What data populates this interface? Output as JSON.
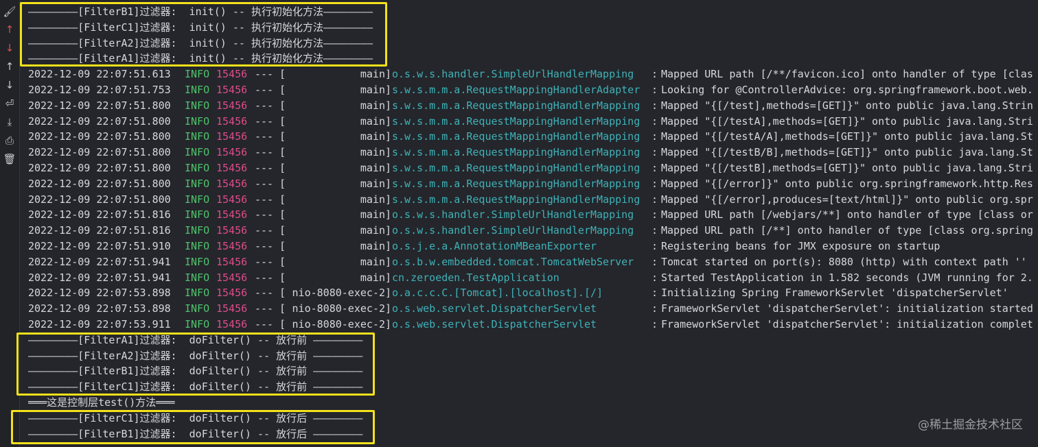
{
  "toolbar": [
    {
      "icon": "brush-icon",
      "glyph": "🖌"
    },
    {
      "icon": "arrow-up-red-icon",
      "glyph": "↑"
    },
    {
      "icon": "arrow-down-red-icon",
      "glyph": "↓"
    },
    {
      "icon": "arrow-up-icon",
      "glyph": "↑"
    },
    {
      "icon": "arrow-down-icon",
      "glyph": "↓"
    },
    {
      "icon": "wrap-lines-icon",
      "glyph": "⏎"
    },
    {
      "icon": "scroll-to-end-icon",
      "glyph": "⤓"
    },
    {
      "icon": "print-icon",
      "glyph": "⎙"
    },
    {
      "icon": "trash-icon",
      "glyph": "🗑"
    }
  ],
  "filter_init": [
    "————————[FilterB1]过滤器:  init() -- 执行初始化方法————————",
    "————————[FilterC1]过滤器:  init() -- 执行初始化方法————————",
    "————————[FilterA2]过滤器:  init() -- 执行初始化方法————————",
    "————————[FilterA1]过滤器:  init() -- 执行初始化方法————————"
  ],
  "log_lines": [
    {
      "ts": "2022-12-09 22:07:51.613",
      "level": "INFO",
      "pid": "15456",
      "sep": "---",
      "thread": "main",
      "logger": "o.s.w.s.handler.SimpleUrlHandlerMapping",
      "msg": "Mapped URL path [/**/favicon.ico] onto handler of type [clas"
    },
    {
      "ts": "2022-12-09 22:07:51.753",
      "level": "INFO",
      "pid": "15456",
      "sep": "---",
      "thread": "main",
      "logger": "s.w.s.m.m.a.RequestMappingHandlerAdapter",
      "msg": "Looking for @ControllerAdvice: org.springframework.boot.web."
    },
    {
      "ts": "2022-12-09 22:07:51.800",
      "level": "INFO",
      "pid": "15456",
      "sep": "---",
      "thread": "main",
      "logger": "s.w.s.m.m.a.RequestMappingHandlerMapping",
      "msg": "Mapped \"{[/test],methods=[GET]}\" onto public java.lang.Strin"
    },
    {
      "ts": "2022-12-09 22:07:51.800",
      "level": "INFO",
      "pid": "15456",
      "sep": "---",
      "thread": "main",
      "logger": "s.w.s.m.m.a.RequestMappingHandlerMapping",
      "msg": "Mapped \"{[/testA],methods=[GET]}\" onto public java.lang.Stri"
    },
    {
      "ts": "2022-12-09 22:07:51.800",
      "level": "INFO",
      "pid": "15456",
      "sep": "---",
      "thread": "main",
      "logger": "s.w.s.m.m.a.RequestMappingHandlerMapping",
      "msg": "Mapped \"{[/testA/A],methods=[GET]}\" onto public java.lang.St"
    },
    {
      "ts": "2022-12-09 22:07:51.800",
      "level": "INFO",
      "pid": "15456",
      "sep": "---",
      "thread": "main",
      "logger": "s.w.s.m.m.a.RequestMappingHandlerMapping",
      "msg": "Mapped \"{[/testB/B],methods=[GET]}\" onto public java.lang.St"
    },
    {
      "ts": "2022-12-09 22:07:51.800",
      "level": "INFO",
      "pid": "15456",
      "sep": "---",
      "thread": "main",
      "logger": "s.w.s.m.m.a.RequestMappingHandlerMapping",
      "msg": "Mapped \"{[/testB],methods=[GET]}\" onto public java.lang.Stri"
    },
    {
      "ts": "2022-12-09 22:07:51.800",
      "level": "INFO",
      "pid": "15456",
      "sep": "---",
      "thread": "main",
      "logger": "s.w.s.m.m.a.RequestMappingHandlerMapping",
      "msg": "Mapped \"{[/error]}\" onto public org.springframework.http.Res"
    },
    {
      "ts": "2022-12-09 22:07:51.800",
      "level": "INFO",
      "pid": "15456",
      "sep": "---",
      "thread": "main",
      "logger": "s.w.s.m.m.a.RequestMappingHandlerMapping",
      "msg": "Mapped \"{[/error],produces=[text/html]}\" onto public org.spr"
    },
    {
      "ts": "2022-12-09 22:07:51.816",
      "level": "INFO",
      "pid": "15456",
      "sep": "---",
      "thread": "main",
      "logger": "o.s.w.s.handler.SimpleUrlHandlerMapping",
      "msg": "Mapped URL path [/webjars/**] onto handler of type [class or"
    },
    {
      "ts": "2022-12-09 22:07:51.816",
      "level": "INFO",
      "pid": "15456",
      "sep": "---",
      "thread": "main",
      "logger": "o.s.w.s.handler.SimpleUrlHandlerMapping",
      "msg": "Mapped URL path [/**] onto handler of type [class org.spring"
    },
    {
      "ts": "2022-12-09 22:07:51.910",
      "level": "INFO",
      "pid": "15456",
      "sep": "---",
      "thread": "main",
      "logger": "o.s.j.e.a.AnnotationMBeanExporter",
      "msg": "Registering beans for JMX exposure on startup"
    },
    {
      "ts": "2022-12-09 22:07:51.941",
      "level": "INFO",
      "pid": "15456",
      "sep": "---",
      "thread": "main",
      "logger": "o.s.b.w.embedded.tomcat.TomcatWebServer",
      "msg": "Tomcat started on port(s): 8080 (http) with context path ''"
    },
    {
      "ts": "2022-12-09 22:07:51.941",
      "level": "INFO",
      "pid": "15456",
      "sep": "---",
      "thread": "main",
      "logger": "cn.zeroeden.TestApplication",
      "msg": "Started TestApplication in 1.582 seconds (JVM running for 2."
    },
    {
      "ts": "2022-12-09 22:07:53.898",
      "level": "INFO",
      "pid": "15456",
      "sep": "---",
      "thread": "nio-8080-exec-2",
      "logger": "o.a.c.c.C.[Tomcat].[localhost].[/]",
      "msg": "Initializing Spring FrameworkServlet 'dispatcherServlet'"
    },
    {
      "ts": "2022-12-09 22:07:53.898",
      "level": "INFO",
      "pid": "15456",
      "sep": "---",
      "thread": "nio-8080-exec-2",
      "logger": "o.s.web.servlet.DispatcherServlet",
      "msg": "FrameworkServlet 'dispatcherServlet': initialization started"
    },
    {
      "ts": "2022-12-09 22:07:53.911",
      "level": "INFO",
      "pid": "15456",
      "sep": "---",
      "thread": "nio-8080-exec-2",
      "logger": "o.s.web.servlet.DispatcherServlet",
      "msg": "FrameworkServlet 'dispatcherServlet': initialization complet"
    }
  ],
  "filter_before": [
    "————————[FilterA1]过滤器:  doFilter() -- 放行前 ————————",
    "————————[FilterA2]过滤器:  doFilter() -- 放行前 ————————",
    "————————[FilterB1]过滤器:  doFilter() -- 放行前 ————————",
    "————————[FilterC1]过滤器:  doFilter() -- 放行前 ————————"
  ],
  "controller_line": "═══这是控制层test()方法═══",
  "filter_after": [
    "————————[FilterC1]过滤器:  doFilter() -- 放行后 ————————",
    "————————[FilterB1]过滤器:  doFilter() -- 放行后 ————————"
  ],
  "watermark": "@稀土掘金技术社区",
  "colors": {
    "background": "#24262b",
    "info": "#4fc36a",
    "pid": "#e04b8a",
    "logger": "#3fb2b8",
    "highlight": "#f5e11a"
  }
}
